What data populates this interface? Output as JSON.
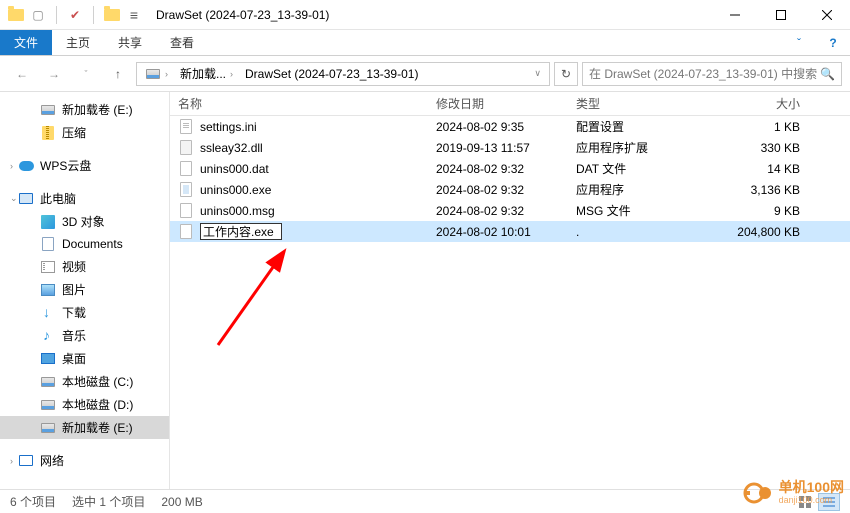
{
  "title": "DrawSet (2024-07-23_13-39-01)",
  "ribbon": {
    "file": "文件",
    "home": "主页",
    "share": "共享",
    "view": "查看"
  },
  "nav": {
    "crumb1": "新加载...",
    "crumb2": "DrawSet (2024-07-23_13-39-01)",
    "search_ph": "在 DrawSet (2024-07-23_13-39-01) 中搜索"
  },
  "sidebar": {
    "items": [
      {
        "label": "新加载卷 (E:)"
      },
      {
        "label": "压缩"
      },
      {
        "label": "WPS云盘"
      },
      {
        "label": "此电脑"
      },
      {
        "label": "3D 对象"
      },
      {
        "label": "Documents"
      },
      {
        "label": "视频"
      },
      {
        "label": "图片"
      },
      {
        "label": "下载"
      },
      {
        "label": "音乐"
      },
      {
        "label": "桌面"
      },
      {
        "label": "本地磁盘 (C:)"
      },
      {
        "label": "本地磁盘 (D:)"
      },
      {
        "label": "新加载卷 (E:)"
      },
      {
        "label": "网络"
      }
    ]
  },
  "columns": {
    "name": "名称",
    "date": "修改日期",
    "type": "类型",
    "size": "大小"
  },
  "files": [
    {
      "name": "settings.ini",
      "date": "2024-08-02 9:35",
      "type": "配置设置",
      "size": "1 KB"
    },
    {
      "name": "ssleay32.dll",
      "date": "2019-09-13 11:57",
      "type": "应用程序扩展",
      "size": "330 KB"
    },
    {
      "name": "unins000.dat",
      "date": "2024-08-02 9:32",
      "type": "DAT 文件",
      "size": "14 KB"
    },
    {
      "name": "unins000.exe",
      "date": "2024-08-02 9:32",
      "type": "应用程序",
      "size": "3,136 KB"
    },
    {
      "name": "unins000.msg",
      "date": "2024-08-02 9:32",
      "type": "MSG 文件",
      "size": "9 KB"
    },
    {
      "name": "工作内容.exe",
      "date": "2024-08-02 10:01",
      "type": ".",
      "size": "204,800 KB"
    }
  ],
  "status": {
    "count": "6 个项目",
    "selected": "选中 1 个项目",
    "size": "200 MB"
  },
  "watermark": {
    "line1": "单机100网",
    "line2": "danji100.com"
  }
}
